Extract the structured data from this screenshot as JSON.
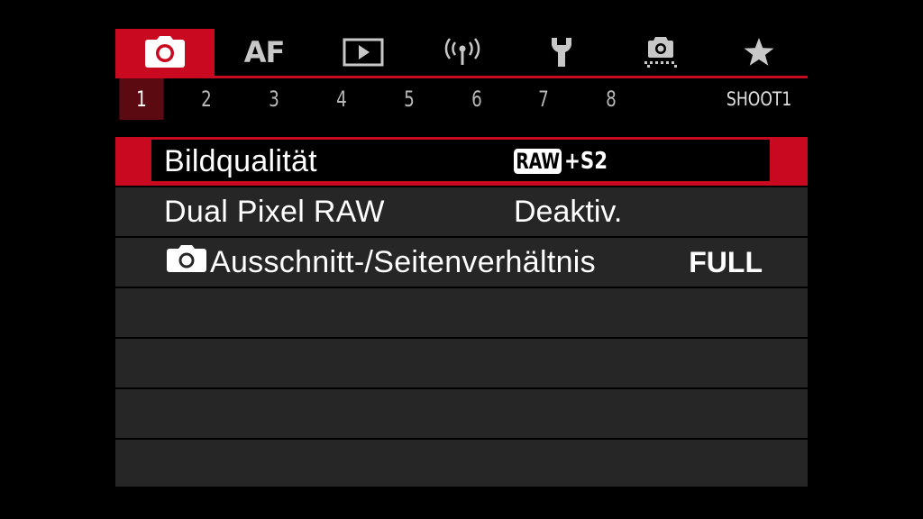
{
  "tabs": [
    {
      "name": "shooting",
      "icon": "camera-icon",
      "active": true
    },
    {
      "name": "af",
      "label": "AF"
    },
    {
      "name": "playback",
      "icon": "playback-icon"
    },
    {
      "name": "wireless",
      "icon": "wireless-icon"
    },
    {
      "name": "setup",
      "icon": "wrench-icon"
    },
    {
      "name": "custom-functions",
      "icon": "custom-functions-icon"
    },
    {
      "name": "my-menu",
      "icon": "star-icon"
    }
  ],
  "pages": {
    "numbers": [
      "1",
      "2",
      "3",
      "4",
      "5",
      "6",
      "7",
      "8"
    ],
    "active": "1",
    "current_name": "SHOOT1"
  },
  "menu": {
    "items": [
      {
        "label": "Bildqualität",
        "value_badge": "RAW",
        "value_suffix": "+S2",
        "selected": true
      },
      {
        "label": "Dual Pixel RAW",
        "value": "Deaktiv."
      },
      {
        "label": "Ausschnitt-/Seitenverhältnis",
        "icon": "camera-icon",
        "value": "FULL"
      }
    ]
  },
  "colors": {
    "accent": "#c8091f",
    "row_bg": "#262626",
    "active_page_bg": "#5a0a10"
  }
}
